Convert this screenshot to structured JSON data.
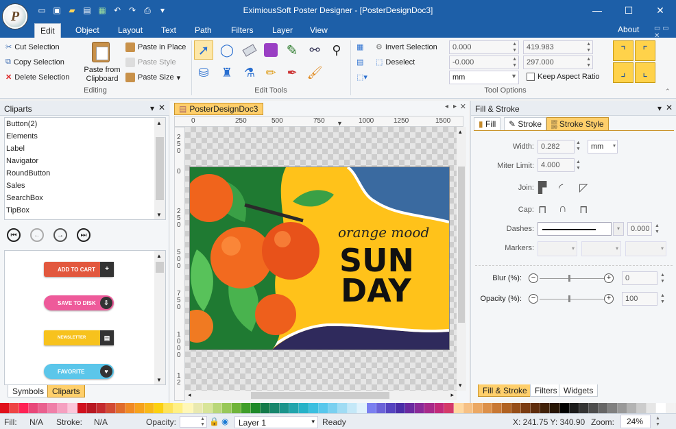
{
  "window": {
    "title": "EximiousSoft Poster Designer - [PosterDesignDoc3]",
    "logo_letter": "P",
    "controls": {
      "minimize": "—",
      "maximize": "☐",
      "close": "✕"
    }
  },
  "quick_access": [
    "new-doc-icon",
    "save-icon",
    "open-folder-icon",
    "save-as-icon",
    "save-all-icon",
    "undo-icon",
    "redo-icon",
    "print-icon",
    "dropdown-icon"
  ],
  "ribbon": {
    "tabs": [
      "Edit",
      "Object",
      "Layout",
      "Text",
      "Path",
      "Filters",
      "Layer",
      "View"
    ],
    "active_tab": "Edit",
    "about": "About",
    "editing": {
      "label": "Editing",
      "cut": "Cut Selection",
      "copy": "Copy Selection",
      "delete": "Delete Selection",
      "paste_clip_line1": "Paste from",
      "paste_clip_line2": "Clipboard",
      "paste_place": "Paste in Place",
      "paste_style": "Paste Style",
      "paste_size": "Paste Size"
    },
    "edit_tools": {
      "label": "Edit Tools"
    },
    "tool_options": {
      "label": "Tool Options",
      "invert": "Invert Selection",
      "deselect": "Deselect",
      "x": "0.000",
      "y": "-0.000",
      "unit": "mm",
      "w": "419.983",
      "h": "297.000",
      "keep_aspect": "Keep Aspect Ratio"
    }
  },
  "left_panel": {
    "title": "Cliparts",
    "categories": [
      "Button(2)",
      "Elements",
      "Label",
      "Navigator",
      "RoundButton",
      "Sales",
      "SearchBox",
      "TipBox"
    ],
    "cliparts": [
      "ADD TO CART",
      "SAVE TO DISK",
      "NEWSLETTER",
      "FAVORITE"
    ],
    "clipart_symbols": [
      "+",
      "⇩",
      "▤",
      "♥"
    ],
    "clip_colors": [
      "#e2583e",
      "#ee5a9a",
      "#f7c21d",
      "#5bc6ea"
    ],
    "tabs": [
      "Symbols",
      "Cliparts"
    ],
    "active_tab": "Cliparts"
  },
  "document": {
    "tab": "PosterDesignDoc3",
    "ruler_h": [
      "0",
      "250",
      "500",
      "750",
      "1000",
      "1250",
      "1500"
    ],
    "ruler_v": [
      "2\n5\n0",
      "0",
      "2\n5\n0",
      "5\n0\n0",
      "7\n5\n0",
      "1\n0\n0\n0",
      "1\n2"
    ],
    "poster": {
      "script_text": "orange mood",
      "line1": "SUN",
      "line2": "DAY",
      "bg_color": "#ffc21a",
      "accent_blue": "#3a6aa0",
      "accent_navy": "#2f2a5c"
    }
  },
  "right_panel": {
    "title": "Fill & Stroke",
    "tabs": [
      "Fill",
      "Stroke",
      "Stroke Style"
    ],
    "active_tab": "Stroke Style",
    "width_label": "Width:",
    "width_value": "0.282",
    "width_unit": "mm",
    "miter_label": "Miter Limit:",
    "miter_value": "4.000",
    "join_label": "Join:",
    "cap_label": "Cap:",
    "dashes_label": "Dashes:",
    "dash_offset": "0.000",
    "markers_label": "Markers:",
    "blur_label": "Blur (%):",
    "blur_value": "0",
    "opacity_label": "Opacity (%):",
    "opacity_value": "100",
    "bottom_tabs": [
      "Fill & Stroke",
      "Filters",
      "Widgets"
    ],
    "bottom_active": "Fill & Stroke"
  },
  "palette": [
    "#e0101a",
    "#e44",
    "#f25",
    "#e8487a",
    "#e9608e",
    "#ef7fa8",
    "#f5a0c0",
    "#fbc6da",
    "#d0101e",
    "#b81822",
    "#c42b2e",
    "#d24b34",
    "#e06c2c",
    "#f08a24",
    "#f6a21c",
    "#f8b817",
    "#fbd010",
    "#fde35a",
    "#fff084",
    "#fff7b8",
    "#e9e9b0",
    "#d8e59a",
    "#b9d77a",
    "#98c85a",
    "#6fb43a",
    "#3f9e2a",
    "#1e8a2a",
    "#137a4a",
    "#16866c",
    "#1b948c",
    "#20a4ac",
    "#26b2c8",
    "#3bbfe0",
    "#58c7ec",
    "#7ad0f0",
    "#a0dcf4",
    "#c4e8f8",
    "#e0f2fc",
    "#7a7ff0",
    "#6a62d8",
    "#5544c0",
    "#4a2ea8",
    "#6a2aa0",
    "#8a2a98",
    "#a82a8a",
    "#c22a7a",
    "#d43a6a",
    "#ffd8a0",
    "#f6c084",
    "#eba864",
    "#dc904a",
    "#c87834",
    "#b06222",
    "#964e18",
    "#7a3c12",
    "#5e2c0c",
    "#402008",
    "#261404",
    "#000",
    "#1a1a1a",
    "#333",
    "#4d4d4d",
    "#666",
    "#808080",
    "#999",
    "#b3b3b3",
    "#ccc",
    "#e6e6e6",
    "#fff",
    "#f2f2f2"
  ],
  "status": {
    "fill_label": "Fill:",
    "fill_value": "N/A",
    "stroke_label": "Stroke:",
    "stroke_value": "N/A",
    "opacity_label": "Opacity:",
    "layer": "Layer 1",
    "state": "Ready",
    "coords": "X: 241.75 Y: 340.90",
    "zoom_label": "Zoom:",
    "zoom_value": "24%"
  }
}
